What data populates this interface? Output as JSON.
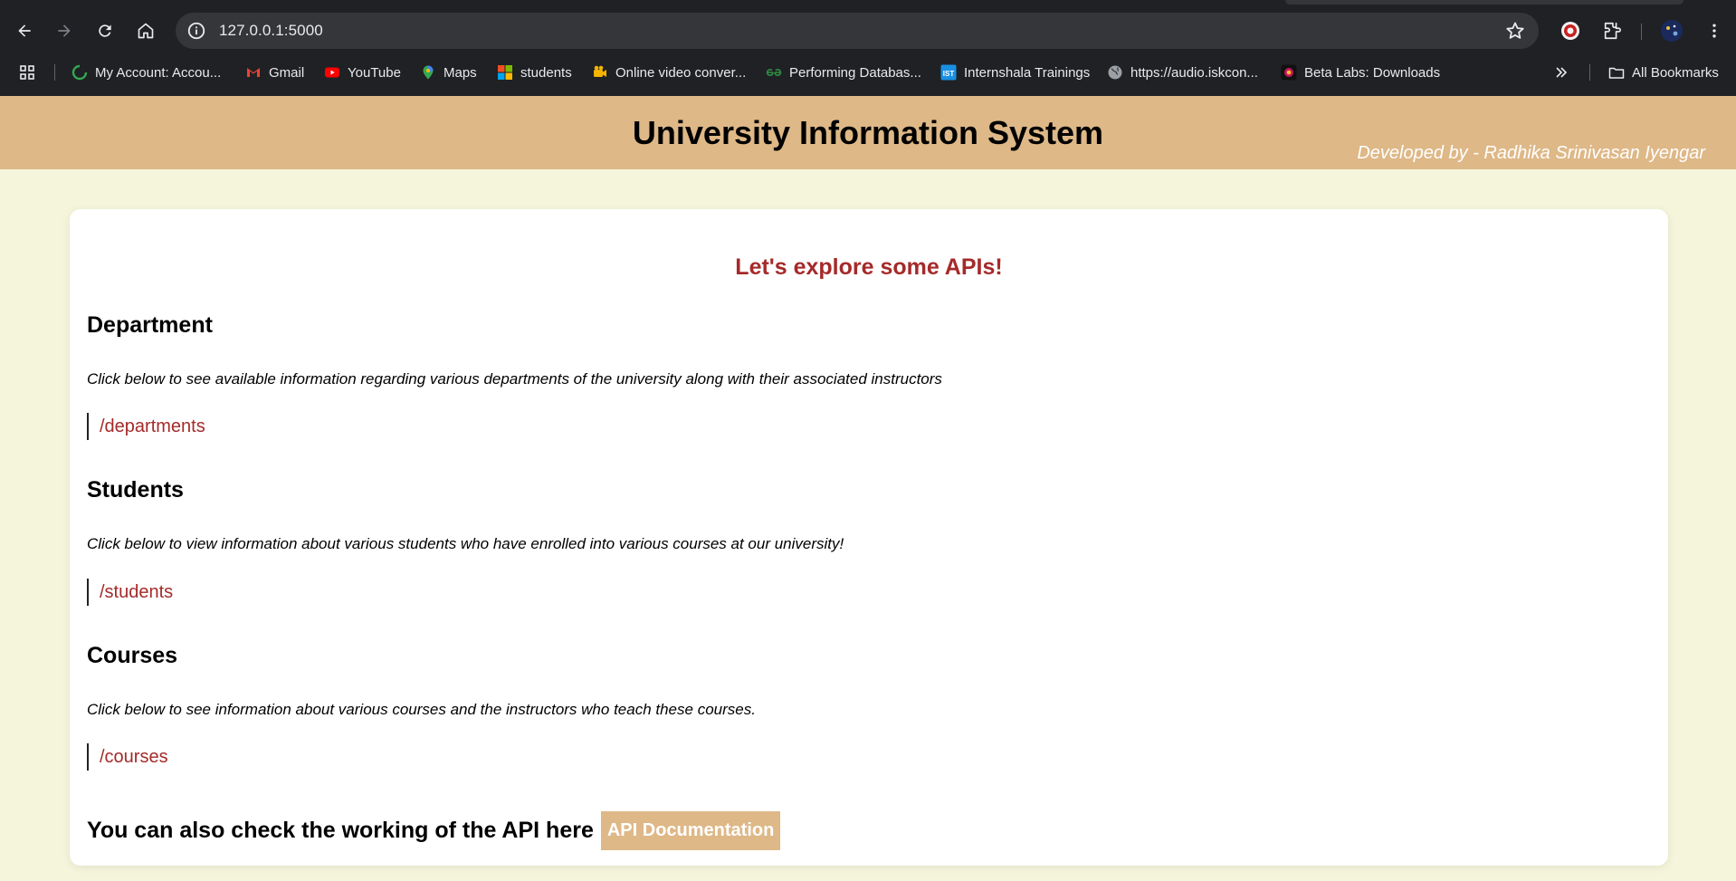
{
  "browser": {
    "url": "127.0.0.1:5000",
    "bookmarks": [
      {
        "label": "My Account: Accou...",
        "icon": "account-icon"
      },
      {
        "label": "Gmail",
        "icon": "gmail-icon"
      },
      {
        "label": "YouTube",
        "icon": "youtube-icon"
      },
      {
        "label": "Maps",
        "icon": "maps-icon"
      },
      {
        "label": "students",
        "icon": "microsoft-icon"
      },
      {
        "label": "Online video conver...",
        "icon": "video-converter-icon"
      },
      {
        "label": "Performing Databas...",
        "icon": "geeksforgeeks-icon"
      },
      {
        "label": "Internshala Trainings",
        "icon": "internshala-icon"
      },
      {
        "label": "https://audio.iskcon...",
        "icon": "globe-icon"
      },
      {
        "label": "Beta Labs: Downloads",
        "icon": "beta-labs-icon"
      }
    ],
    "all_bookmarks_label": "All Bookmarks"
  },
  "page": {
    "title": "University Information System",
    "developer_credit": "Developed by - Radhika Srinivasan Iyengar",
    "intro": "Let's explore some APIs!",
    "sections": [
      {
        "heading": "Department",
        "description": "Click below to see available information regarding various departments of the university along with their associated instructors",
        "link": "/departments"
      },
      {
        "heading": "Students",
        "description": "Click below to view information about various students who have enrolled into various courses at our university!",
        "link": "/students"
      },
      {
        "heading": "Courses",
        "description": "Click below to see information about various courses and the instructors who teach these courses.",
        "link": "/courses"
      }
    ],
    "footer_text": "You can also check the working of the API here",
    "api_doc_button": "API Documentation"
  },
  "colors": {
    "header_bg": "#deb887",
    "page_bg": "#f5f5dc",
    "accent": "#a52a2a",
    "card_bg": "#ffffff"
  }
}
